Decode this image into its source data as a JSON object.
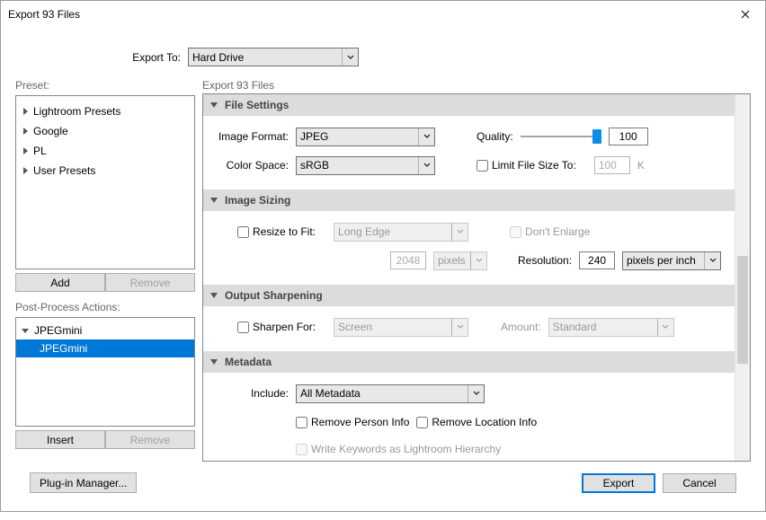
{
  "window": {
    "title": "Export 93 Files"
  },
  "top": {
    "export_to_label": "Export To:",
    "export_to_value": "Hard Drive"
  },
  "left": {
    "preset_label": "Preset:",
    "presets": [
      "Lightroom Presets",
      "Google",
      "PL",
      "User Presets"
    ],
    "add": "Add",
    "remove": "Remove",
    "ppa_label": "Post-Process Actions:",
    "ppa_group": "JPEGmini",
    "ppa_item": "JPEGmini",
    "insert": "Insert",
    "remove2": "Remove"
  },
  "main": {
    "title": "Export 93 Files",
    "file_settings": {
      "header": "File Settings",
      "image_format_label": "Image Format:",
      "image_format_value": "JPEG",
      "quality_label": "Quality:",
      "quality_value": "100",
      "color_space_label": "Color Space:",
      "color_space_value": "sRGB",
      "limit_label": "Limit File Size To:",
      "limit_value": "100",
      "limit_unit": "K"
    },
    "image_sizing": {
      "header": "Image Sizing",
      "resize_label": "Resize to Fit:",
      "resize_value": "Long Edge",
      "dont_enlarge": "Don't Enlarge",
      "dim_value": "2048",
      "dim_unit": "pixels",
      "resolution_label": "Resolution:",
      "resolution_value": "240",
      "resolution_unit": "pixels per inch"
    },
    "sharpening": {
      "header": "Output Sharpening",
      "sharpen_label": "Sharpen For:",
      "sharpen_value": "Screen",
      "amount_label": "Amount:",
      "amount_value": "Standard"
    },
    "metadata": {
      "header": "Metadata",
      "include_label": "Include:",
      "include_value": "All Metadata",
      "remove_person": "Remove Person Info",
      "remove_location": "Remove Location Info",
      "write_keywords": "Write Keywords as Lightroom Hierarchy"
    }
  },
  "footer": {
    "plugin": "Plug-in Manager...",
    "export": "Export",
    "cancel": "Cancel"
  }
}
